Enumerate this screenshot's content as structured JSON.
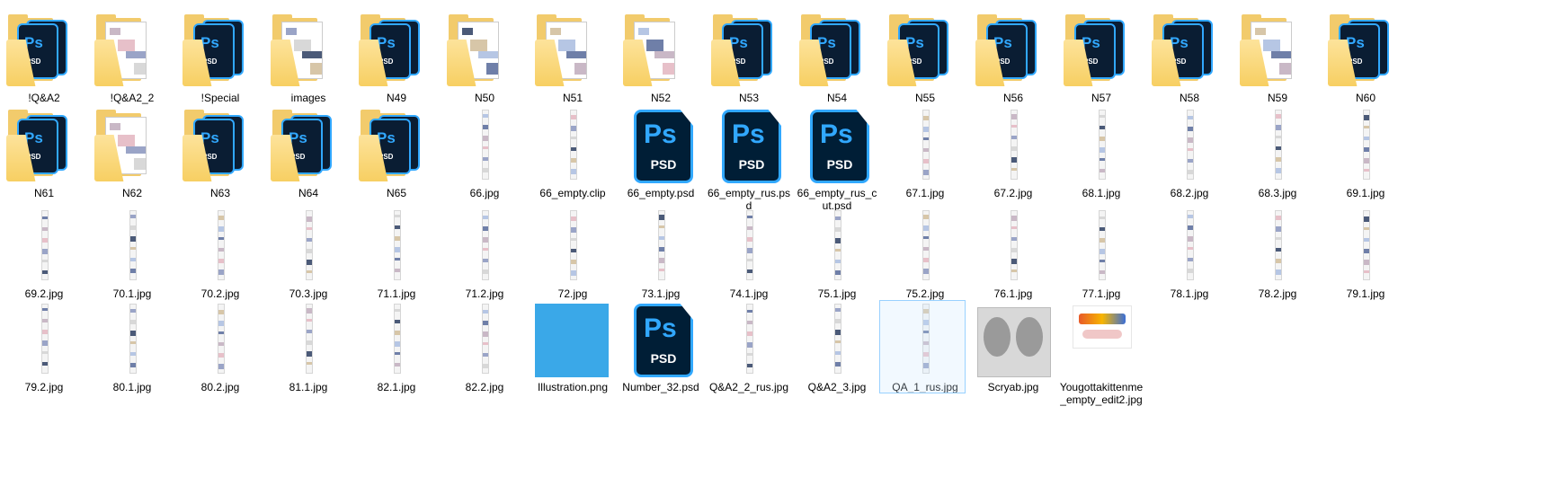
{
  "view": "Explorer large icons",
  "items": [
    {
      "name": "!Q&A2",
      "type": "folder-psd"
    },
    {
      "name": "!Q&A2_2",
      "type": "folder-pic"
    },
    {
      "name": "!Special",
      "type": "folder-psd"
    },
    {
      "name": "images",
      "type": "folder-pic"
    },
    {
      "name": "N49",
      "type": "folder-psd"
    },
    {
      "name": "N50",
      "type": "folder-pic"
    },
    {
      "name": "N51",
      "type": "folder-pic"
    },
    {
      "name": "N52",
      "type": "folder-pic"
    },
    {
      "name": "N53",
      "type": "folder-psd"
    },
    {
      "name": "N54",
      "type": "folder-psd"
    },
    {
      "name": "N55",
      "type": "folder-psd"
    },
    {
      "name": "N56",
      "type": "folder-psd"
    },
    {
      "name": "N57",
      "type": "folder-psd"
    },
    {
      "name": "N58",
      "type": "folder-psd"
    },
    {
      "name": "N59",
      "type": "folder-pic"
    },
    {
      "name": "N60",
      "type": "folder-psd"
    },
    {
      "name": "N61",
      "type": "folder-psd"
    },
    {
      "name": "N62",
      "type": "folder-pic"
    },
    {
      "name": "N63",
      "type": "folder-psd"
    },
    {
      "name": "N64",
      "type": "folder-psd"
    },
    {
      "name": "N65",
      "type": "folder-psd"
    },
    {
      "name": "66.jpg",
      "type": "strip"
    },
    {
      "name": "66_empty.clip",
      "type": "strip"
    },
    {
      "name": "66_empty.psd",
      "type": "psd"
    },
    {
      "name": "66_empty_rus.psd",
      "type": "psd"
    },
    {
      "name": "66_empty_rus_cut.psd",
      "type": "psd"
    },
    {
      "name": "67.1.jpg",
      "type": "strip"
    },
    {
      "name": "67.2.jpg",
      "type": "strip"
    },
    {
      "name": "68.1.jpg",
      "type": "strip"
    },
    {
      "name": "68.2.jpg",
      "type": "strip"
    },
    {
      "name": "68.3.jpg",
      "type": "strip"
    },
    {
      "name": "69.1.jpg",
      "type": "strip"
    },
    {
      "name": "69.2.jpg",
      "type": "strip"
    },
    {
      "name": "70.1.jpg",
      "type": "strip"
    },
    {
      "name": "70.2.jpg",
      "type": "strip"
    },
    {
      "name": "70.3.jpg",
      "type": "strip"
    },
    {
      "name": "71.1.jpg",
      "type": "strip"
    },
    {
      "name": "71.2.jpg",
      "type": "strip"
    },
    {
      "name": "72.jpg",
      "type": "strip"
    },
    {
      "name": "73.1.jpg",
      "type": "strip"
    },
    {
      "name": "74.1.jpg",
      "type": "strip"
    },
    {
      "name": "75.1.jpg",
      "type": "strip"
    },
    {
      "name": "75.2.jpg",
      "type": "strip"
    },
    {
      "name": "76.1.jpg",
      "type": "strip"
    },
    {
      "name": "77.1.jpg",
      "type": "strip"
    },
    {
      "name": "78.1.jpg",
      "type": "strip"
    },
    {
      "name": "78.2.jpg",
      "type": "strip"
    },
    {
      "name": "79.1.jpg",
      "type": "strip"
    },
    {
      "name": "79.2.jpg",
      "type": "strip"
    },
    {
      "name": "80.1.jpg",
      "type": "strip"
    },
    {
      "name": "80.2.jpg",
      "type": "strip"
    },
    {
      "name": "81.1.jpg",
      "type": "strip"
    },
    {
      "name": "82.1.jpg",
      "type": "strip"
    },
    {
      "name": "82.2.jpg",
      "type": "strip"
    },
    {
      "name": "Illustration.png",
      "type": "bluepng"
    },
    {
      "name": "Number_32.psd",
      "type": "psd"
    },
    {
      "name": "Q&A2_2_rus.jpg",
      "type": "strip"
    },
    {
      "name": "Q&A2_3.jpg",
      "type": "strip"
    },
    {
      "name": "QA_1_rus.jpg",
      "type": "strip",
      "selected": true
    },
    {
      "name": "Scryab.jpg",
      "type": "scry"
    },
    {
      "name": "Yougottakittenme_empty_edit2.jpg",
      "type": "kit"
    }
  ],
  "psd_text": {
    "logo": "Ps",
    "ext": "PSD"
  }
}
